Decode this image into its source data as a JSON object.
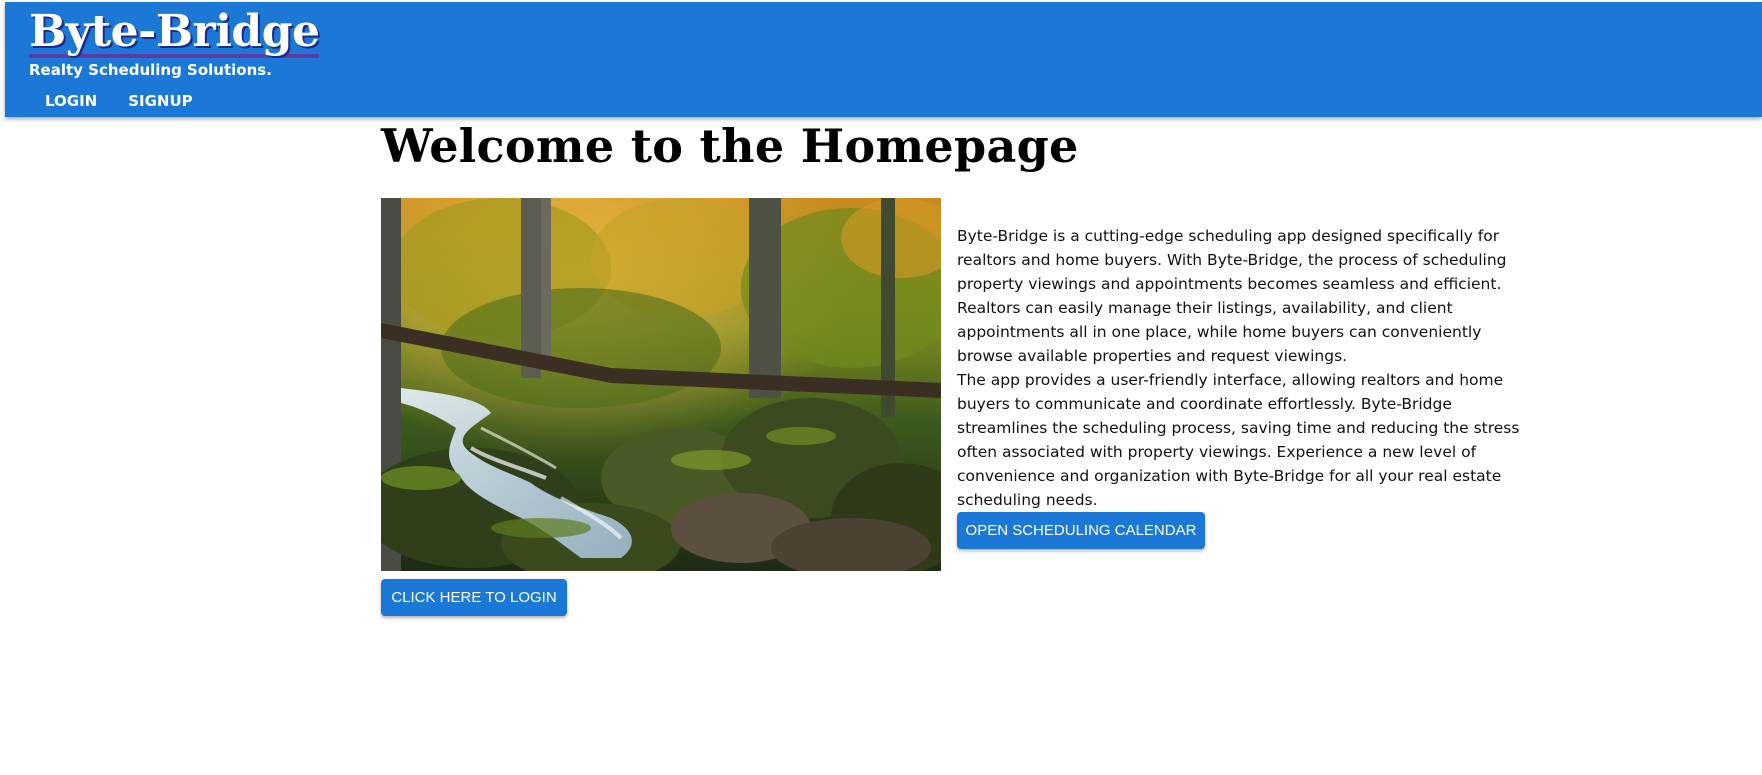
{
  "header": {
    "brand": "Byte-Bridge",
    "tagline": "Realty Scheduling Solutions.",
    "nav": [
      {
        "label": "LOGIN"
      },
      {
        "label": "SIGNUP"
      }
    ]
  },
  "main": {
    "title": "Welcome to the Homepage",
    "paragraphs": [
      "Byte-Bridge is a cutting-edge scheduling app designed specifically for realtors and home buyers. With Byte-Bridge, the process of scheduling property viewings and appointments becomes seamless and efficient. Realtors can easily manage their listings, availability, and client appointments all in one place, while home buyers can conveniently browse available properties and request viewings.",
      "The app provides a user-friendly interface, allowing realtors and home buyers to communicate and coordinate effortlessly. Byte-Bridge streamlines the scheduling process, saving time and reducing the stress often associated with property viewings. Experience a new level of convenience and organization with Byte-Bridge for all your real estate scheduling needs."
    ],
    "calendar_button": "OPEN SCHEDULING CALENDAR",
    "login_button": "CLICK HERE TO LOGIN"
  },
  "colors": {
    "appbar": "#1b78d6",
    "button": "#1b78d6"
  }
}
